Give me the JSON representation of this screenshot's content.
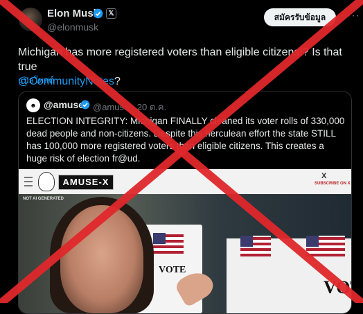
{
  "header": {
    "name": "Elon Musk",
    "badge_x": "𝕏",
    "handle": "@elonmusk",
    "subscribe_label": "สมัครรับข้อมูล",
    "more_label": "···"
  },
  "tweet": {
    "text": "Michigan has more registered voters than eligible citizens!? Is that true",
    "mention": "@CommunityNotes",
    "after_mention": "?",
    "translate_label": "แปลโพสต์"
  },
  "quote": {
    "name": "@amuse",
    "handle_date": "@amuse · 20 ต.ค.",
    "text": "ELECTION INTEGRITY: Michigan FINALLY cleaned its voter rolls of 330,000 dead people and non-citizens. Despite this herculean effort the state STILL has 100,000 more registered voters than eligible citizens. This creates a huge risk of election fr@ud.",
    "image": {
      "logo": "AMUSE-X",
      "x_mark": "X",
      "subscribe_text": "SUBSCRIBE ON X",
      "not_ai": "NOT AI GENERATED",
      "vote_1": "VOTE",
      "vote_2": "VOTE"
    }
  },
  "colors": {
    "accent": "#1d9bf0",
    "cross": "#e0282c",
    "background": "#000000"
  }
}
